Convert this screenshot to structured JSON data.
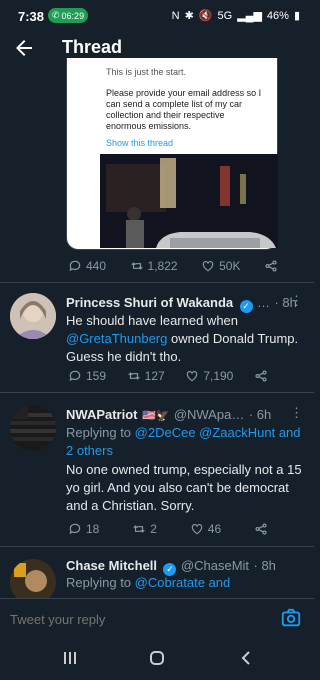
{
  "status": {
    "time": "7:38",
    "call": "06:29",
    "battery": "46%",
    "network": "5G"
  },
  "header": {
    "title": "Thread"
  },
  "quoted": {
    "top_text": "This is just the start.",
    "text": "Please provide your email address so I can send a complete list of my car collection and their respective enormous emissions.",
    "show_thread": "Show this thread"
  },
  "main_actions": {
    "replies": "440",
    "retweets": "1,822",
    "likes": "50K"
  },
  "tweets": [
    {
      "name": "Princess Shuri of Wakanda",
      "time": "· 8h",
      "handle": "…",
      "body_pre": "He should have learned when ",
      "mention": "@GretaThunberg",
      "body_post": " owned Donald Trump. Guess he didn't tho.",
      "replies": "159",
      "retweets": "127",
      "likes": "7,190"
    },
    {
      "name": "NWAPatriot",
      "flags": "🇺🇸🦅",
      "handle": "@NWApa…",
      "time": "· 6h",
      "replying_label": "Replying to ",
      "replying_to": "@2DeCee @ZaackHunt and 2 others",
      "body": "No one owned trump, especially not a 15 yo girl. And you also can't be democrat and a Christian. Sorry.",
      "replies": "18",
      "retweets": "2",
      "likes": "46"
    },
    {
      "name": "Chase Mitchell",
      "handle": "@ChaseMit",
      "time": "· 8h",
      "replying_label": "Replying to ",
      "replying_to": "@Cobratate and"
    }
  ],
  "reply": {
    "placeholder": "Tweet your reply"
  },
  "icons": [
    "back-arrow-icon",
    "reply-icon",
    "retweet-icon",
    "like-icon",
    "share-icon",
    "verified-icon",
    "camera-icon",
    "more-icon"
  ],
  "colors": {
    "bg": "#15202b",
    "accent": "#1d9bf0",
    "muted": "#8b98a5"
  }
}
